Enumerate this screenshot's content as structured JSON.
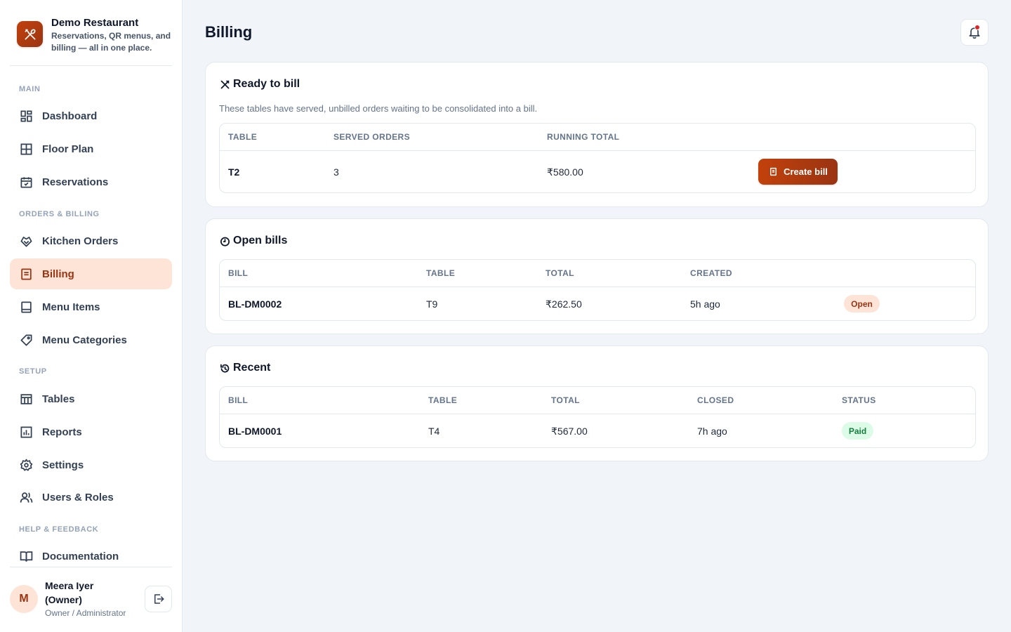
{
  "brand": {
    "name": "Demo Restaurant",
    "tagline": "Reservations, QR menus, and billing — all in one place."
  },
  "sidebar": {
    "sections": {
      "main": "MAIN",
      "orders_billing": "ORDERS & BILLING",
      "setup": "SETUP",
      "help": "HELP & FEEDBACK"
    },
    "items": {
      "dashboard": "Dashboard",
      "floor_plan": "Floor Plan",
      "reservations": "Reservations",
      "kitchen_orders": "Kitchen Orders",
      "billing": "Billing",
      "menu_items": "Menu Items",
      "menu_categories": "Menu Categories",
      "tables": "Tables",
      "reports": "Reports",
      "settings": "Settings",
      "users_roles": "Users & Roles",
      "documentation": "Documentation"
    },
    "active": "billing"
  },
  "user": {
    "initial": "M",
    "name": "Meera Iyer (Owner)",
    "role": "Owner / Administrator"
  },
  "page": {
    "title": "Billing"
  },
  "ready_to_bill": {
    "title": "Ready to bill",
    "description": "These tables have served, unbilled orders waiting to be consolidated into a bill.",
    "columns": {
      "table": "TABLE",
      "served_orders": "SERVED ORDERS",
      "running_total": "RUNNING TOTAL"
    },
    "rows": [
      {
        "table": "T2",
        "served_orders": "3",
        "running_total": "₹580.00",
        "action": "Create bill"
      }
    ]
  },
  "open_bills": {
    "title": "Open bills",
    "columns": {
      "bill": "BILL",
      "table": "TABLE",
      "total": "TOTAL",
      "created": "CREATED"
    },
    "rows": [
      {
        "bill": "BL-DM0002",
        "table": "T9",
        "total": "₹262.50",
        "created": "5h ago",
        "status": "Open"
      }
    ]
  },
  "recent": {
    "title": "Recent",
    "columns": {
      "bill": "BILL",
      "table": "TABLE",
      "total": "TOTAL",
      "closed": "CLOSED",
      "status": "STATUS"
    },
    "rows": [
      {
        "bill": "BL-DM0001",
        "table": "T4",
        "total": "₹567.00",
        "closed": "7h ago",
        "status": "Paid"
      }
    ]
  },
  "colors": {
    "accent": "#c2410c",
    "accent_dark": "#9a3412",
    "active_bg": "#fde4d6",
    "paid_bg": "#dcfce7",
    "paid_text": "#15803d",
    "notification_dot": "#dc2626"
  },
  "icons": {
    "brand": "utensils-icon",
    "dashboard": "grid-icon",
    "floor_plan": "floor-grid-icon",
    "reservations": "calendar-check-icon",
    "kitchen_orders": "kitchen-icon",
    "billing": "receipt-icon",
    "menu_items": "book-icon",
    "menu_categories": "tag-icon",
    "tables": "table-icon",
    "reports": "chart-icon",
    "settings": "gear-icon",
    "users_roles": "users-icon",
    "documentation": "book-open-icon",
    "logout": "logout-icon",
    "bell": "bell-icon",
    "ready": "utensils-icon",
    "open": "clock-icon",
    "recent": "history-icon"
  }
}
